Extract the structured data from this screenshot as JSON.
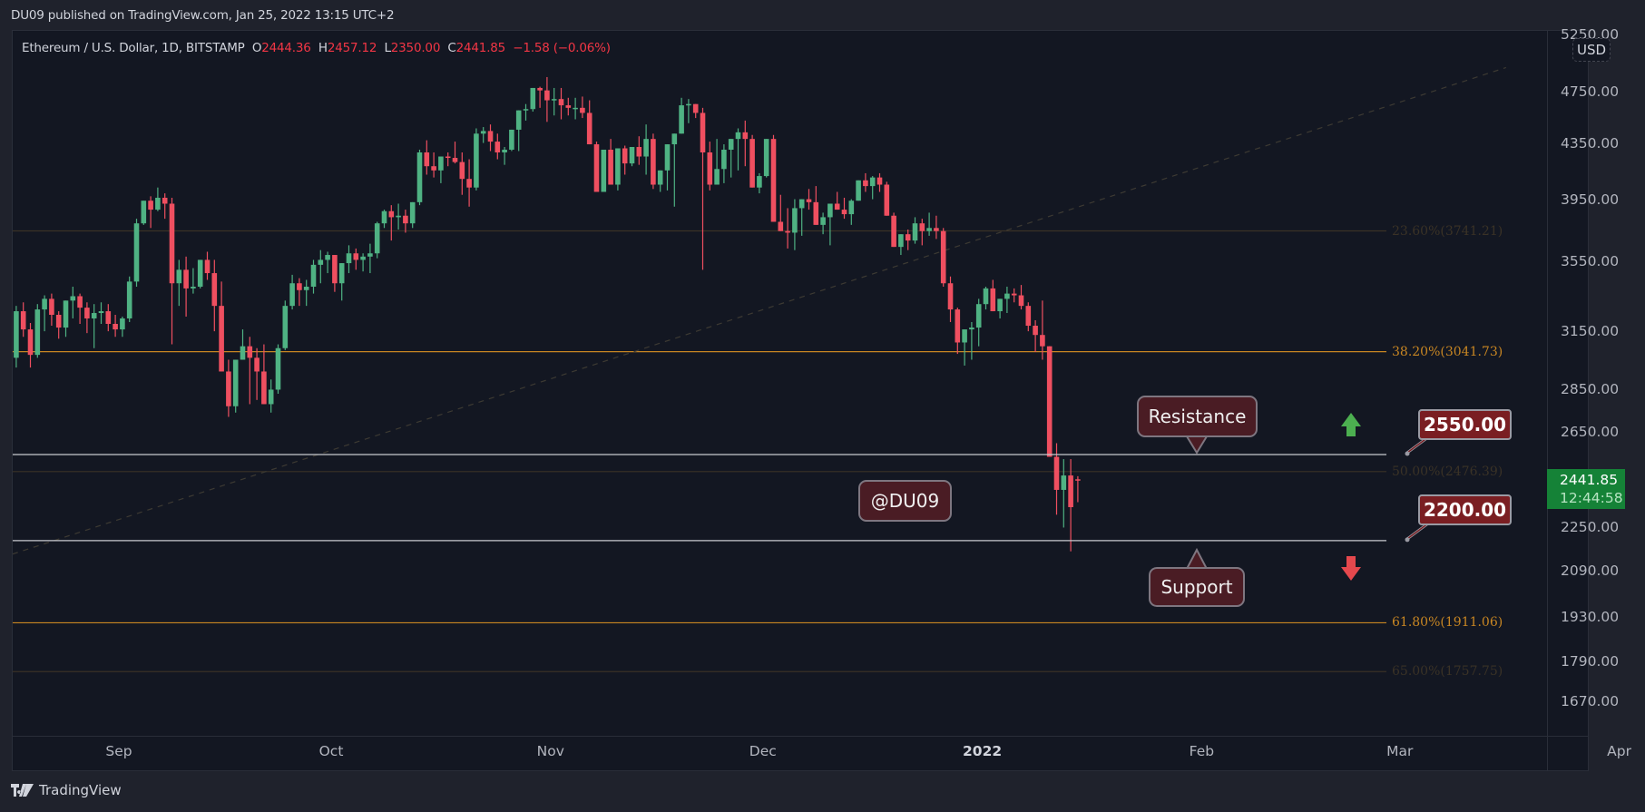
{
  "header": {
    "published": "DU09 published on TradingView.com, Jan 25, 2022 13:15 UTC+2"
  },
  "legend": {
    "symbol": "Ethereum / U.S. Dollar, 1D, BITSTAMP",
    "o_label": "O",
    "o": "2444.36",
    "h_label": "H",
    "h": "2457.12",
    "l_label": "L",
    "l": "2350.00",
    "c_label": "C",
    "c": "2441.85",
    "change": "−1.58 (−0.06%)"
  },
  "price_axis": {
    "currency": "USD",
    "last_price": "2441.85",
    "countdown": "12:44:58"
  },
  "annotations": {
    "resistance": "Resistance",
    "support": "Support",
    "watermark": "@DU09",
    "resistance_price": "2550.00",
    "support_price": "2200.00",
    "up_arrow": "up-arrow-icon",
    "down_arrow": "down-arrow-icon"
  },
  "footer": {
    "brand": "TradingView"
  },
  "colors": {
    "up": "#4fb283",
    "down": "#ef4f60",
    "fib_active": "#c88622",
    "fib_faded": "#3a3226",
    "label_bg": "#7a1e22",
    "last_price_bg": "#158237"
  },
  "chart_data": {
    "type": "candlestick",
    "title": "Ethereum / U.S. Dollar, 1D, BITSTAMP",
    "scale": "log",
    "ylim": [
      1590,
      5300
    ],
    "y_ticks": [
      "5250.00",
      "4750.00",
      "4350.00",
      "3950.00",
      "3550.00",
      "3150.00",
      "2850.00",
      "2650.00",
      "2250.00",
      "2090.00",
      "1930.00",
      "1790.00",
      "1670.00"
    ],
    "x_ticks": [
      "Sep",
      "Oct",
      "Nov",
      "Dec",
      "2022",
      "Feb",
      "Mar",
      "Apr"
    ],
    "x_tick_day_offsets": [
      15,
      45,
      76,
      106,
      137,
      168,
      196,
      227
    ],
    "first_day": "2021-08-17",
    "horizontal_lines": [
      {
        "name": "resistance",
        "value": 2550
      },
      {
        "name": "support",
        "value": 2200
      }
    ],
    "fib_levels": [
      {
        "label": "23.60%(3741.21)",
        "value": 3741.21,
        "active": false
      },
      {
        "label": "38.20%(3041.73)",
        "value": 3041.73,
        "active": true
      },
      {
        "label": "50.00%(2476.39)",
        "value": 2476.39,
        "active": false
      },
      {
        "label": "61.80%(1911.06)",
        "value": 1911.06,
        "active": true
      },
      {
        "label": "65.00%(1757.75)",
        "value": 1757.75,
        "active": false
      }
    ],
    "trendline": {
      "style": "dashed",
      "from": {
        "day": 0,
        "value": 2150
      },
      "to": {
        "day": 211,
        "value": 4950
      }
    },
    "candles": [
      [
        3010,
        3290,
        2960,
        3260
      ],
      [
        3260,
        3310,
        3120,
        3160
      ],
      [
        3160,
        3195,
        2960,
        3025
      ],
      [
        3025,
        3300,
        3010,
        3270
      ],
      [
        3270,
        3350,
        3150,
        3330
      ],
      [
        3330,
        3360,
        3180,
        3240
      ],
      [
        3240,
        3260,
        3110,
        3170
      ],
      [
        3170,
        3280,
        3120,
        3320
      ],
      [
        3320,
        3400,
        3220,
        3345
      ],
      [
        3345,
        3360,
        3190,
        3280
      ],
      [
        3280,
        3310,
        3140,
        3220
      ],
      [
        3220,
        3300,
        3060,
        3250
      ],
      [
        3250,
        3310,
        3190,
        3260
      ],
      [
        3260,
        3300,
        3150,
        3190
      ],
      [
        3190,
        3240,
        3120,
        3160
      ],
      [
        3160,
        3230,
        3120,
        3220
      ],
      [
        3220,
        3460,
        3200,
        3430
      ],
      [
        3430,
        3820,
        3400,
        3790
      ],
      [
        3790,
        3930,
        3780,
        3940
      ],
      [
        3940,
        3970,
        3760,
        3880
      ],
      [
        3880,
        4030,
        3870,
        3960
      ],
      [
        3960,
        3990,
        3820,
        3920
      ],
      [
        3920,
        3960,
        3080,
        3420
      ],
      [
        3420,
        3560,
        3290,
        3500
      ],
      [
        3500,
        3580,
        3230,
        3390
      ],
      [
        3390,
        3510,
        3360,
        3400
      ],
      [
        3400,
        3560,
        3390,
        3560
      ],
      [
        3560,
        3610,
        3440,
        3480
      ],
      [
        3480,
        3560,
        3150,
        3290
      ],
      [
        3290,
        3430,
        3090,
        2940
      ],
      [
        2940,
        3000,
        2720,
        2770
      ],
      [
        2770,
        2930,
        2740,
        3000
      ],
      [
        3000,
        3160,
        3000,
        3070
      ],
      [
        3070,
        3120,
        2780,
        3010
      ],
      [
        3010,
        3060,
        2800,
        2940
      ],
      [
        2940,
        3080,
        2920,
        2780
      ],
      [
        2780,
        2900,
        2740,
        2850
      ],
      [
        2850,
        3080,
        2830,
        3060
      ],
      [
        3060,
        3320,
        3050,
        3290
      ],
      [
        3290,
        3470,
        3270,
        3420
      ],
      [
        3420,
        3450,
        3290,
        3380
      ],
      [
        3380,
        3440,
        3290,
        3400
      ],
      [
        3400,
        3560,
        3360,
        3530
      ],
      [
        3530,
        3620,
        3420,
        3560
      ],
      [
        3560,
        3610,
        3480,
        3590
      ],
      [
        3590,
        3550,
        3370,
        3420
      ],
      [
        3420,
        3480,
        3320,
        3540
      ],
      [
        3540,
        3650,
        3480,
        3600
      ],
      [
        3600,
        3630,
        3500,
        3560
      ],
      [
        3560,
        3600,
        3490,
        3580
      ],
      [
        3580,
        3660,
        3480,
        3600
      ],
      [
        3600,
        3800,
        3570,
        3790
      ],
      [
        3790,
        3880,
        3760,
        3870
      ],
      [
        3870,
        3910,
        3680,
        3830
      ],
      [
        3830,
        3920,
        3750,
        3840
      ],
      [
        3840,
        3880,
        3730,
        3790
      ],
      [
        3790,
        3930,
        3760,
        3930
      ],
      [
        3930,
        4300,
        3910,
        4280
      ],
      [
        4280,
        4370,
        4120,
        4180
      ],
      [
        4180,
        4280,
        4100,
        4150
      ],
      [
        4150,
        4220,
        4060,
        4250
      ],
      [
        4250,
        4280,
        4180,
        4240
      ],
      [
        4240,
        4360,
        4200,
        4210
      ],
      [
        4210,
        4280,
        3980,
        4090
      ],
      [
        4090,
        4230,
        3900,
        4030
      ],
      [
        4030,
        4460,
        4010,
        4420
      ],
      [
        4420,
        4470,
        4350,
        4440
      ],
      [
        4440,
        4490,
        4290,
        4360
      ],
      [
        4360,
        4420,
        4230,
        4280
      ],
      [
        4280,
        4320,
        4190,
        4300
      ],
      [
        4300,
        4440,
        4290,
        4450
      ],
      [
        4450,
        4460,
        4290,
        4600
      ],
      [
        4600,
        4650,
        4520,
        4610
      ],
      [
        4610,
        4720,
        4590,
        4780
      ],
      [
        4780,
        4790,
        4620,
        4760
      ],
      [
        4760,
        4870,
        4510,
        4680
      ],
      [
        4680,
        4780,
        4560,
        4690
      ],
      [
        4690,
        4780,
        4530,
        4640
      ],
      [
        4640,
        4700,
        4560,
        4620
      ],
      [
        4620,
        4700,
        4530,
        4620
      ],
      [
        4620,
        4710,
        4540,
        4580
      ],
      [
        4580,
        4680,
        4450,
        4340
      ],
      [
        4340,
        4360,
        4160,
        4000
      ],
      [
        4000,
        4250,
        4120,
        4300
      ],
      [
        4300,
        4380,
        4060,
        4050
      ],
      [
        4050,
        4300,
        4010,
        4310
      ],
      [
        4310,
        4330,
        4120,
        4200
      ],
      [
        4200,
        4280,
        4180,
        4320
      ],
      [
        4320,
        4400,
        4190,
        4250
      ],
      [
        4250,
        4490,
        4120,
        4380
      ],
      [
        4380,
        4420,
        4020,
        4050
      ],
      [
        4050,
        4120,
        4000,
        4150
      ],
      [
        4150,
        4260,
        4010,
        4340
      ],
      [
        4340,
        4350,
        3900,
        4420
      ],
      [
        4420,
        4700,
        4420,
        4640
      ],
      [
        4640,
        4690,
        4500,
        4650
      ],
      [
        4650,
        4640,
        4540,
        4580
      ],
      [
        4580,
        4620,
        3500,
        4280
      ],
      [
        4280,
        4360,
        4010,
        4050
      ],
      [
        4050,
        4380,
        4110,
        4160
      ],
      [
        4160,
        4340,
        4060,
        4300
      ],
      [
        4300,
        4380,
        4100,
        4380
      ],
      [
        4380,
        4460,
        4150,
        4430
      ],
      [
        4430,
        4520,
        4180,
        4380
      ],
      [
        4380,
        4410,
        4070,
        4030
      ],
      [
        4030,
        4130,
        3990,
        4110
      ],
      [
        4110,
        4360,
        4100,
        4380
      ],
      [
        4380,
        4410,
        3850,
        3800
      ],
      [
        3800,
        3980,
        3790,
        3740
      ],
      [
        3740,
        3890,
        3630,
        3730
      ],
      [
        3730,
        3950,
        3620,
        3890
      ],
      [
        3890,
        3930,
        3710,
        3950
      ],
      [
        3950,
        4020,
        3880,
        3930
      ],
      [
        3930,
        4040,
        3860,
        3780
      ],
      [
        3780,
        3860,
        3720,
        3830
      ],
      [
        3830,
        3910,
        3650,
        3920
      ],
      [
        3920,
        4000,
        3880,
        3880
      ],
      [
        3880,
        3960,
        3820,
        3850
      ],
      [
        3850,
        3950,
        3780,
        3940
      ],
      [
        3940,
        4060,
        3940,
        4080
      ],
      [
        4080,
        4130,
        4000,
        4040
      ],
      [
        4040,
        4110,
        3950,
        4100
      ],
      [
        4100,
        4130,
        4000,
        4050
      ],
      [
        4050,
        4070,
        3970,
        3840
      ],
      [
        3840,
        3860,
        3730,
        3640
      ],
      [
        3640,
        3700,
        3590,
        3720
      ],
      [
        3720,
        3750,
        3620,
        3680
      ],
      [
        3680,
        3830,
        3660,
        3790
      ],
      [
        3790,
        3820,
        3650,
        3740
      ],
      [
        3740,
        3860,
        3710,
        3760
      ],
      [
        3760,
        3840,
        3690,
        3740
      ],
      [
        3740,
        3760,
        3400,
        3420
      ],
      [
        3420,
        3460,
        3200,
        3270
      ],
      [
        3270,
        3280,
        3030,
        3090
      ],
      [
        3090,
        3140,
        2970,
        3160
      ],
      [
        3160,
        3200,
        3000,
        3170
      ],
      [
        3170,
        3330,
        3070,
        3300
      ],
      [
        3300,
        3400,
        3270,
        3390
      ],
      [
        3390,
        3440,
        3290,
        3260
      ],
      [
        3260,
        3310,
        3220,
        3330
      ],
      [
        3330,
        3400,
        3250,
        3360
      ],
      [
        3360,
        3390,
        3310,
        3350
      ],
      [
        3350,
        3410,
        3270,
        3290
      ],
      [
        3290,
        3310,
        3150,
        3180
      ],
      [
        3180,
        3210,
        3040,
        3130
      ],
      [
        3130,
        3320,
        3000,
        3070
      ],
      [
        3070,
        3060,
        2800,
        2540
      ],
      [
        2540,
        2600,
        2300,
        2400
      ],
      [
        2400,
        2530,
        2250,
        2460
      ],
      [
        2460,
        2530,
        2160,
        2330
      ],
      [
        2444,
        2457,
        2350,
        2442
      ]
    ]
  }
}
